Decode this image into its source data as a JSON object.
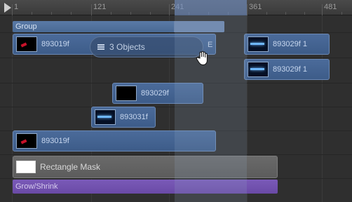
{
  "ruler": {
    "ticks": [
      "1",
      "121",
      "241",
      "361",
      "481"
    ]
  },
  "group": {
    "label": "Group"
  },
  "selection": {
    "label": "3 Objects",
    "edge_label": "E"
  },
  "clips": {
    "row1_a": "893019f",
    "row1_b": "893029f 1",
    "row2_b": "893029f 1",
    "row3": "893029f",
    "row4": "893031f",
    "row5": "893019f"
  },
  "mask": {
    "label": "Rectangle Mask"
  },
  "behavior": {
    "label": "Grow/Shrink"
  },
  "colors": {
    "clip": "#4b6b9a",
    "group": "#5a7aa6",
    "behavior": "#7a5ab8",
    "mask": "#6a6a6a",
    "background": "#2f2f2f"
  }
}
